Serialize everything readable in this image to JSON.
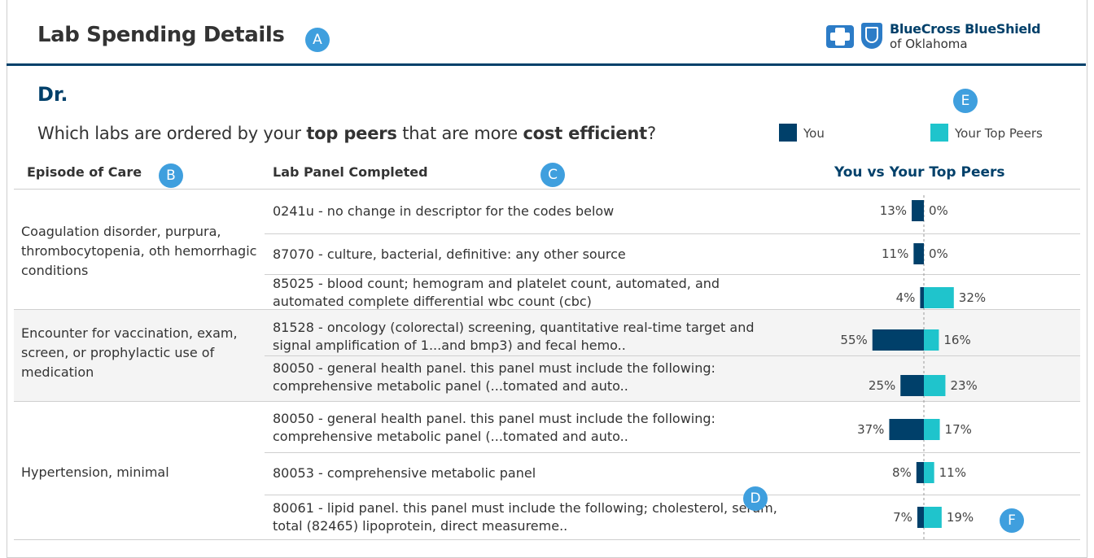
{
  "header": {
    "title": "Lab Spending Details",
    "logo": {
      "line1": "BlueCross BlueShield",
      "line2": "of Oklahoma"
    }
  },
  "markers": {
    "a": "A",
    "b": "B",
    "c": "C",
    "d": "D",
    "e": "E",
    "f": "F"
  },
  "doctor": "Dr.",
  "question": {
    "part1": "Which labs are ordered by your ",
    "bold1": "top peers",
    "part2": " that are more ",
    "bold2": "cost efficient",
    "part3": "?"
  },
  "legend": {
    "you": "You",
    "peers": "Your Top Peers"
  },
  "columns": {
    "episode": "Episode of Care",
    "lab": "Lab Panel Completed",
    "chart": "You vs Your Top Peers"
  },
  "colors": {
    "you": "#00406a",
    "peers": "#1fc4cc",
    "accent": "#00406a",
    "marker": "#3f9fde"
  },
  "chart_data": {
    "type": "bar",
    "orientation": "diverging-horizontal",
    "unit": "%",
    "series": [
      {
        "name": "You",
        "color": "#00406a",
        "values": [
          13,
          11,
          4,
          55,
          25,
          37,
          8,
          7
        ]
      },
      {
        "name": "Your Top Peers",
        "color": "#1fc4cc",
        "values": [
          0,
          0,
          32,
          16,
          23,
          17,
          11,
          19
        ]
      }
    ],
    "categories": [
      "0241u",
      "87070",
      "85025",
      "81528",
      "80050",
      "80050",
      "80053",
      "80061"
    ],
    "groups": [
      {
        "episode": "Coagulation disorder, purpura, thrombocytopenia, oth hemorrhagic conditions",
        "rows": [
          {
            "lab": "0241u - no change in descriptor for the codes below",
            "you": "13%",
            "peers": "0%"
          },
          {
            "lab": "87070 - culture, bacterial, definitive: any other source",
            "you": "11%",
            "peers": "0%"
          },
          {
            "lab": "85025 - blood count; hemogram and platelet count, automated, and automated complete differential wbc count (cbc)",
            "you": "4%",
            "peers": "32%"
          }
        ]
      },
      {
        "episode": "Encounter for vaccination, exam, screen, or prophylactic use of medication",
        "rows": [
          {
            "lab": "81528 - oncology (colorectal) screening, quantitative real-time target and signal amplification of 1...and bmp3) and fecal hemo..",
            "you": "55%",
            "peers": "16%"
          },
          {
            "lab": "80050 - general health panel. this panel must include the following: comprehensive metabolic panel (...tomated and auto..",
            "you": "25%",
            "peers": "23%"
          }
        ]
      },
      {
        "episode": "Hypertension, minimal",
        "rows": [
          {
            "lab": "80050 - general health panel. this panel must include the following: comprehensive metabolic panel (...tomated and auto..",
            "you": "37%",
            "peers": "17%"
          },
          {
            "lab": "80053 - comprehensive metabolic panel",
            "you": "8%",
            "peers": "11%"
          },
          {
            "lab": "80061 - lipid panel. this panel must include the following; cholesterol, serum, total (82465) lipoprotein, direct measureme..",
            "you": "7%",
            "peers": "19%"
          }
        ]
      }
    ]
  }
}
